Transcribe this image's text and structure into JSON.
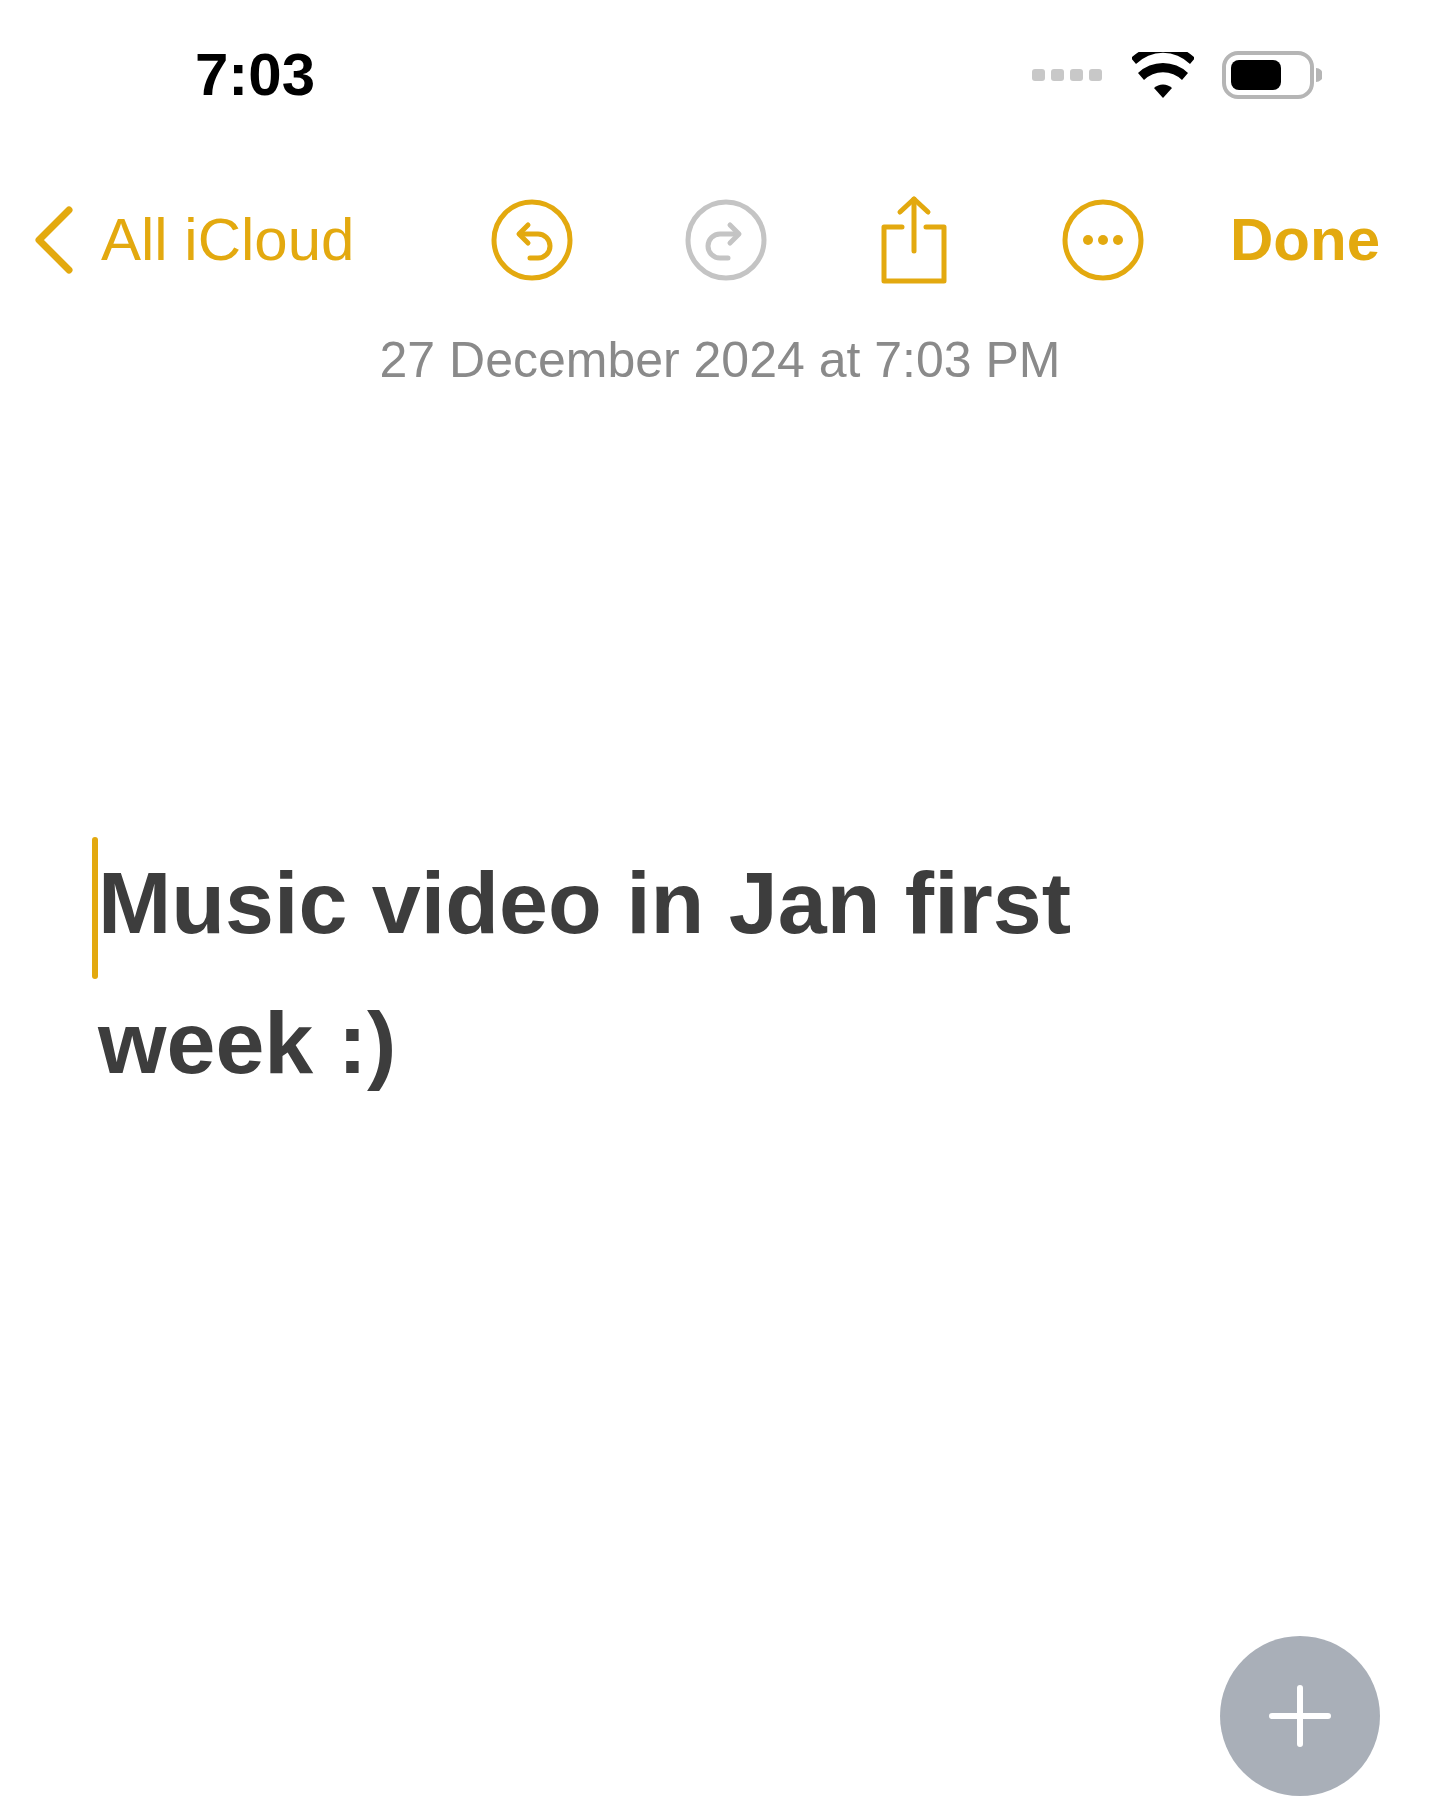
{
  "status_bar": {
    "time": "7:03"
  },
  "nav": {
    "back_label": "All iCloud",
    "tools": [
      {
        "kind": "undo",
        "disabled": false
      },
      {
        "kind": "redo",
        "disabled": true
      },
      {
        "kind": "share",
        "disabled": false
      },
      {
        "kind": "more",
        "disabled": false
      }
    ],
    "done_label": "Done"
  },
  "note": {
    "date": "27 December 2024 at 7:03 PM",
    "body": "Music video in Jan first week :)"
  }
}
